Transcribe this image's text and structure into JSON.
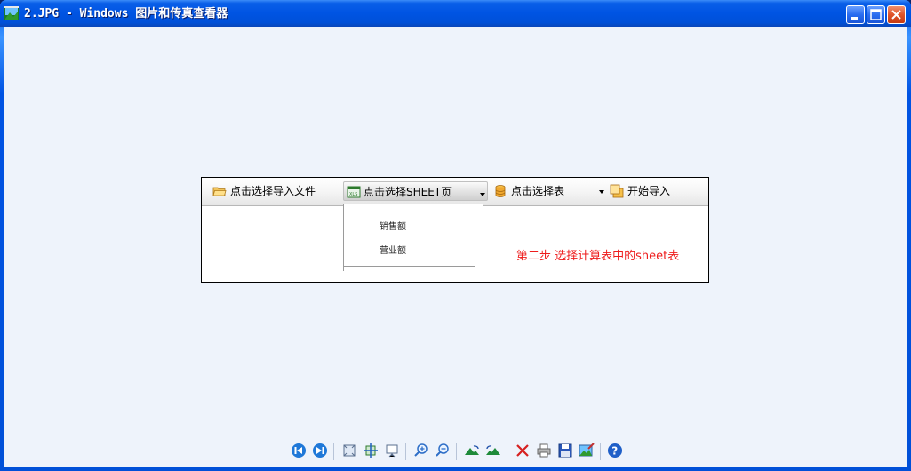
{
  "window": {
    "title": "2.JPG - Windows 图片和传真查看器",
    "controls": [
      "minimize",
      "maximize",
      "close"
    ]
  },
  "picture": {
    "toolbar": {
      "import_file": "点击选择导入文件",
      "select_sheet": "点击选择SHEET页",
      "select_table": "点击选择表",
      "start_import": "开始导入"
    },
    "dropdown": {
      "items": [
        "销售额",
        "营业额"
      ]
    },
    "hint": "第二步 选择计算表中的sheet表"
  },
  "viewer_toolbar": {
    "buttons": [
      "previous-image-icon",
      "next-image-icon",
      "best-fit-icon",
      "actual-size-icon",
      "slideshow-icon",
      "zoom-in-icon",
      "zoom-out-icon",
      "rotate-clockwise-icon",
      "rotate-counterclockwise-icon",
      "delete-icon",
      "print-icon",
      "save-icon",
      "edit-icon",
      "help-icon"
    ]
  },
  "colors": {
    "titlebar": "#0054e3",
    "client_bg": "#eef3fb",
    "hint_text": "#ee1c1c"
  }
}
